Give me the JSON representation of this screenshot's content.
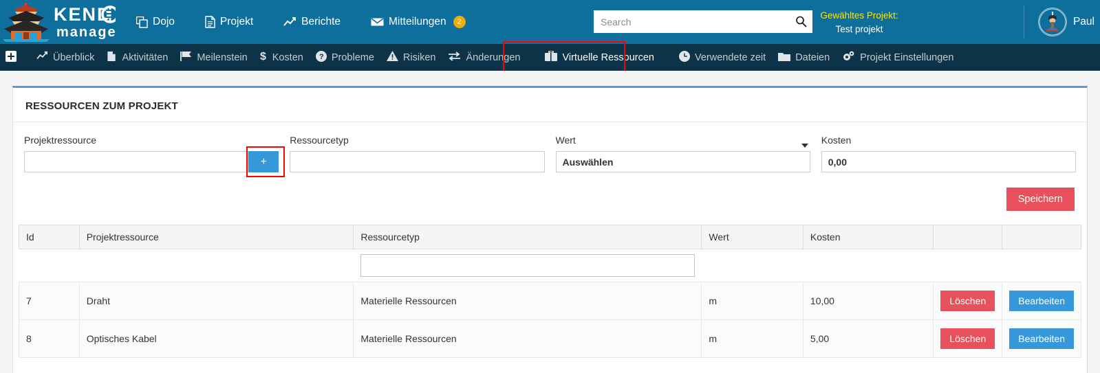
{
  "brand": {
    "name_top": "KENDO",
    "name_bottom": "manager",
    "logo_icon": "pagoda-logo-icon"
  },
  "topnav": {
    "items": [
      {
        "label": "Dojo",
        "icon": "copy-icon"
      },
      {
        "label": "Projekt",
        "icon": "document-icon"
      },
      {
        "label": "Berichte",
        "icon": "chart-line-icon"
      },
      {
        "label": "Mitteilungen",
        "icon": "envelope-icon",
        "badge": "2"
      }
    ]
  },
  "search": {
    "placeholder": "Search",
    "value": "",
    "icon": "search-icon"
  },
  "selected_project": {
    "label": "Gewähltes Projekt:",
    "value": "Test projekt"
  },
  "user": {
    "name": "Paul",
    "avatar_icon": "samurai-avatar-icon"
  },
  "subnav": {
    "add_icon": "plus-square-icon",
    "items": [
      {
        "label": "Überblick",
        "icon": "chart-line-icon",
        "active": false
      },
      {
        "label": "Aktivitäten",
        "icon": "file-copy-icon",
        "active": false
      },
      {
        "label": "Meilenstein",
        "icon": "flag-icon",
        "active": false
      },
      {
        "label": "Kosten",
        "icon": "dollar-icon",
        "active": false
      },
      {
        "label": "Probleme",
        "icon": "question-circle-icon",
        "active": false
      },
      {
        "label": "Risiken",
        "icon": "warning-triangle-icon",
        "active": false
      },
      {
        "label": "Änderungen",
        "icon": "exchange-icon",
        "active": false
      },
      {
        "label": "Virtuelle Ressourcen",
        "icon": "briefcase-icon",
        "active": true
      },
      {
        "label": "Verwendete zeit",
        "icon": "clock-icon",
        "active": false
      },
      {
        "label": "Dateien",
        "icon": "folder-icon",
        "active": false
      },
      {
        "label": "Projekt Einstellungen",
        "icon": "gears-icon",
        "active": false
      }
    ]
  },
  "card": {
    "title": "RESSOURCEN ZUM PROJEKT",
    "fields": {
      "projektressource": {
        "label": "Projektressource",
        "value": "",
        "add_button_label": "+"
      },
      "ressourcetyp": {
        "label": "Ressourcetyp",
        "value": ""
      },
      "wert": {
        "label": "Wert",
        "value": "Auswählen"
      },
      "kosten": {
        "label": "Kosten",
        "value": "0,00"
      }
    },
    "save_label": "Speichern"
  },
  "table": {
    "headers": [
      "Id",
      "Projektressource",
      "Ressourcetyp",
      "Wert",
      "Kosten",
      "",
      ""
    ],
    "filter": {
      "ressourcetyp_value": ""
    },
    "rows": [
      {
        "id": "7",
        "projektressource": "Draht",
        "ressourcetyp": "Materielle Ressourcen",
        "wert": "m",
        "kosten": "10,00",
        "delete_label": "Löschen",
        "edit_label": "Bearbeiten"
      },
      {
        "id": "8",
        "projektressource": "Optisches Kabel",
        "ressourcetyp": "Materielle Ressourcen",
        "wert": "m",
        "kosten": "5,00",
        "delete_label": "Löschen",
        "edit_label": "Bearbeiten"
      }
    ]
  },
  "colors": {
    "topbar": "#0e6e9c",
    "subnav": "#0d3349",
    "accent_blue": "#3498db",
    "danger_red": "#e8505b",
    "highlight_box": "#ff0000",
    "badge_yellow": "#f0ad00",
    "project_label_yellow": "#ffe600"
  }
}
